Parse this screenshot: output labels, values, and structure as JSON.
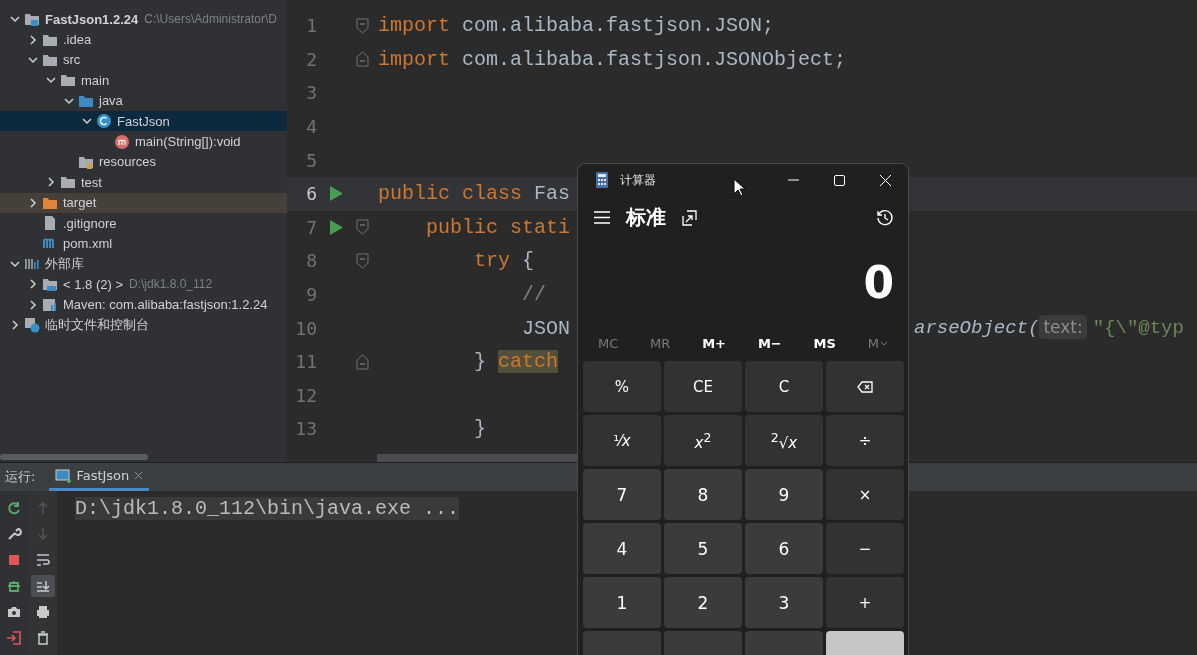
{
  "project_tree": [
    {
      "label": "FastJson1.2.24",
      "detail": "C:\\Users\\Administrator\\D",
      "kind": "project",
      "expanded": true,
      "selected": false,
      "children": [
        {
          "label": ".idea",
          "kind": "folder",
          "expanded": false,
          "selected": false
        },
        {
          "label": "src",
          "kind": "folder",
          "expanded": true,
          "selected": false,
          "children": [
            {
              "label": "main",
              "kind": "folder",
              "expanded": true,
              "selected": false,
              "children": [
                {
                  "label": "java",
                  "kind": "source-folder",
                  "expanded": true,
                  "selected": false,
                  "children": [
                    {
                      "label": "FastJson",
                      "kind": "class",
                      "expanded": true,
                      "selected": true,
                      "children": [
                        {
                          "label": "main(String[]):void",
                          "kind": "method",
                          "selected": false
                        }
                      ]
                    }
                  ]
                },
                {
                  "label": "resources",
                  "kind": "resources",
                  "selected": false
                }
              ]
            },
            {
              "label": "test",
              "kind": "folder",
              "expanded": false,
              "selected": false
            }
          ]
        },
        {
          "label": "target",
          "kind": "excluded-folder",
          "expanded": false,
          "selected": false
        },
        {
          "label": ".gitignore",
          "kind": "file",
          "selected": false
        },
        {
          "label": "pom.xml",
          "kind": "maven",
          "selected": false
        }
      ]
    },
    {
      "label": "外部库",
      "kind": "libraries",
      "expanded": true,
      "selected": false,
      "children": [
        {
          "label": "< 1.8 (2) >",
          "detail": "D:\\jdk1.8.0_112",
          "kind": "jdk",
          "expanded": false,
          "selected": false
        },
        {
          "label": "Maven: com.alibaba:fastjson:1.2.24",
          "kind": "library",
          "expanded": false,
          "selected": false
        }
      ]
    },
    {
      "label": "临时文件和控制台",
      "kind": "scratch",
      "expanded": false,
      "selected": false
    }
  ],
  "editor": {
    "lines": [
      {
        "number": "1",
        "current": false,
        "run": false,
        "kind": "fold-start",
        "left": [
          {
            "kind": "keyword",
            "text": "import"
          },
          {
            "kind": "plain",
            "text": "com.alibaba.fastjson.JSON;"
          }
        ]
      },
      {
        "number": "2",
        "current": false,
        "run": false,
        "kind": "fold-end",
        "left": [
          {
            "kind": "keyword",
            "text": "import"
          },
          {
            "kind": "plain",
            "text": "com.alibaba.fastjson.JSONObject;"
          }
        ]
      },
      {
        "number": "3",
        "current": false,
        "run": false,
        "kind": "plain"
      },
      {
        "number": "4",
        "current": false,
        "run": false,
        "kind": "plain"
      },
      {
        "number": "5",
        "current": false,
        "run": false,
        "kind": "plain"
      },
      {
        "number": "6",
        "current": true,
        "run": true,
        "kind": "plain",
        "left": [
          {
            "kind": "keyword",
            "text": "public class"
          },
          {
            "kind": "plain",
            "text": "Fas"
          }
        ]
      },
      {
        "number": "7",
        "current": false,
        "run": true,
        "kind": "fold-start",
        "left": [
          {
            "kind": "keyword",
            "text": "    public stati"
          }
        ]
      },
      {
        "number": "8",
        "current": false,
        "run": false,
        "kind": "fold-start",
        "left": [
          {
            "kind": "keyword",
            "text": "        try"
          },
          {
            "kind": "plain",
            "text": "{"
          }
        ]
      },
      {
        "number": "9",
        "current": false,
        "run": false,
        "kind": "plain",
        "left": [
          {
            "kind": "comment",
            "text": "            //"
          }
        ]
      },
      {
        "number": "10",
        "current": false,
        "run": false,
        "kind": "plain",
        "left": [
          {
            "kind": "plain",
            "text": "            JSON"
          }
        ],
        "right": [
          {
            "kind": "call",
            "text": "arseObject("
          },
          {
            "kind": "hint",
            "text": "text:"
          },
          {
            "kind": "string",
            "text": "\"{\\\"@typ"
          }
        ]
      },
      {
        "number": "11",
        "current": false,
        "run": false,
        "kind": "fold-end",
        "left": [
          {
            "kind": "plain",
            "text": "        }"
          },
          {
            "kind": "match",
            "text": "catch"
          }
        ]
      },
      {
        "number": "12",
        "current": false,
        "run": false,
        "kind": "plain"
      },
      {
        "number": "13",
        "current": false,
        "run": false,
        "kind": "plain",
        "left": [
          {
            "kind": "plain",
            "text": "        }"
          }
        ]
      }
    ]
  },
  "run_panel": {
    "label": "运行:",
    "tab": {
      "label": "FastJson",
      "selected": true
    },
    "console": [
      "D:\\jdk1.8.0_112\\bin\\java.exe ..."
    ],
    "left_tools": [
      {
        "kind": "rerun"
      },
      {
        "kind": "settings"
      },
      {
        "kind": "stop"
      },
      {
        "kind": "debug"
      },
      {
        "kind": "camera"
      },
      {
        "kind": "exit"
      }
    ],
    "right_tools": [
      {
        "kind": "up",
        "disabled": true,
        "selected": false
      },
      {
        "kind": "down",
        "disabled": true,
        "selected": false
      },
      {
        "kind": "wrap",
        "disabled": false,
        "selected": false
      },
      {
        "kind": "scroll-end",
        "disabled": false,
        "selected": true
      },
      {
        "kind": "print",
        "disabled": false,
        "selected": false
      },
      {
        "kind": "trash",
        "disabled": false,
        "selected": false
      }
    ]
  },
  "calculator": {
    "title": "计算器",
    "mode": "标准",
    "display": "0",
    "memory": [
      {
        "label": "MC",
        "disabled": true,
        "kind": "plain"
      },
      {
        "label": "MR",
        "disabled": true,
        "kind": "plain"
      },
      {
        "label": "M+",
        "disabled": false,
        "kind": "plain"
      },
      {
        "label": "M−",
        "disabled": false,
        "kind": "plain"
      },
      {
        "label": "MS",
        "disabled": false,
        "kind": "plain"
      },
      {
        "label": "M",
        "disabled": true,
        "kind": "menu"
      }
    ],
    "keys": [
      {
        "kind": "function",
        "label": "%"
      },
      {
        "kind": "function",
        "label": "CE"
      },
      {
        "kind": "function",
        "label": "C"
      },
      {
        "kind": "backspace"
      },
      {
        "kind": "function",
        "label": "¹⁄*x*"
      },
      {
        "kind": "function",
        "label": "*x*$^{2}$"
      },
      {
        "kind": "function",
        "label": "$^{2}$√*x*"
      },
      {
        "kind": "operator",
        "label": "÷"
      },
      {
        "kind": "digit",
        "label": "7"
      },
      {
        "kind": "digit",
        "label": "8"
      },
      {
        "kind": "digit",
        "label": "9"
      },
      {
        "kind": "operator",
        "label": "×"
      },
      {
        "kind": "digit",
        "label": "4"
      },
      {
        "kind": "digit",
        "label": "5"
      },
      {
        "kind": "digit",
        "label": "6"
      },
      {
        "kind": "operator",
        "label": "−"
      },
      {
        "kind": "digit",
        "label": "1"
      },
      {
        "kind": "digit",
        "label": "2"
      },
      {
        "kind": "digit",
        "label": "3"
      },
      {
        "kind": "operator",
        "label": "+"
      },
      {
        "kind": "digit"
      },
      {
        "kind": "digit"
      },
      {
        "kind": "digit"
      },
      {
        "kind": "equals"
      }
    ]
  }
}
